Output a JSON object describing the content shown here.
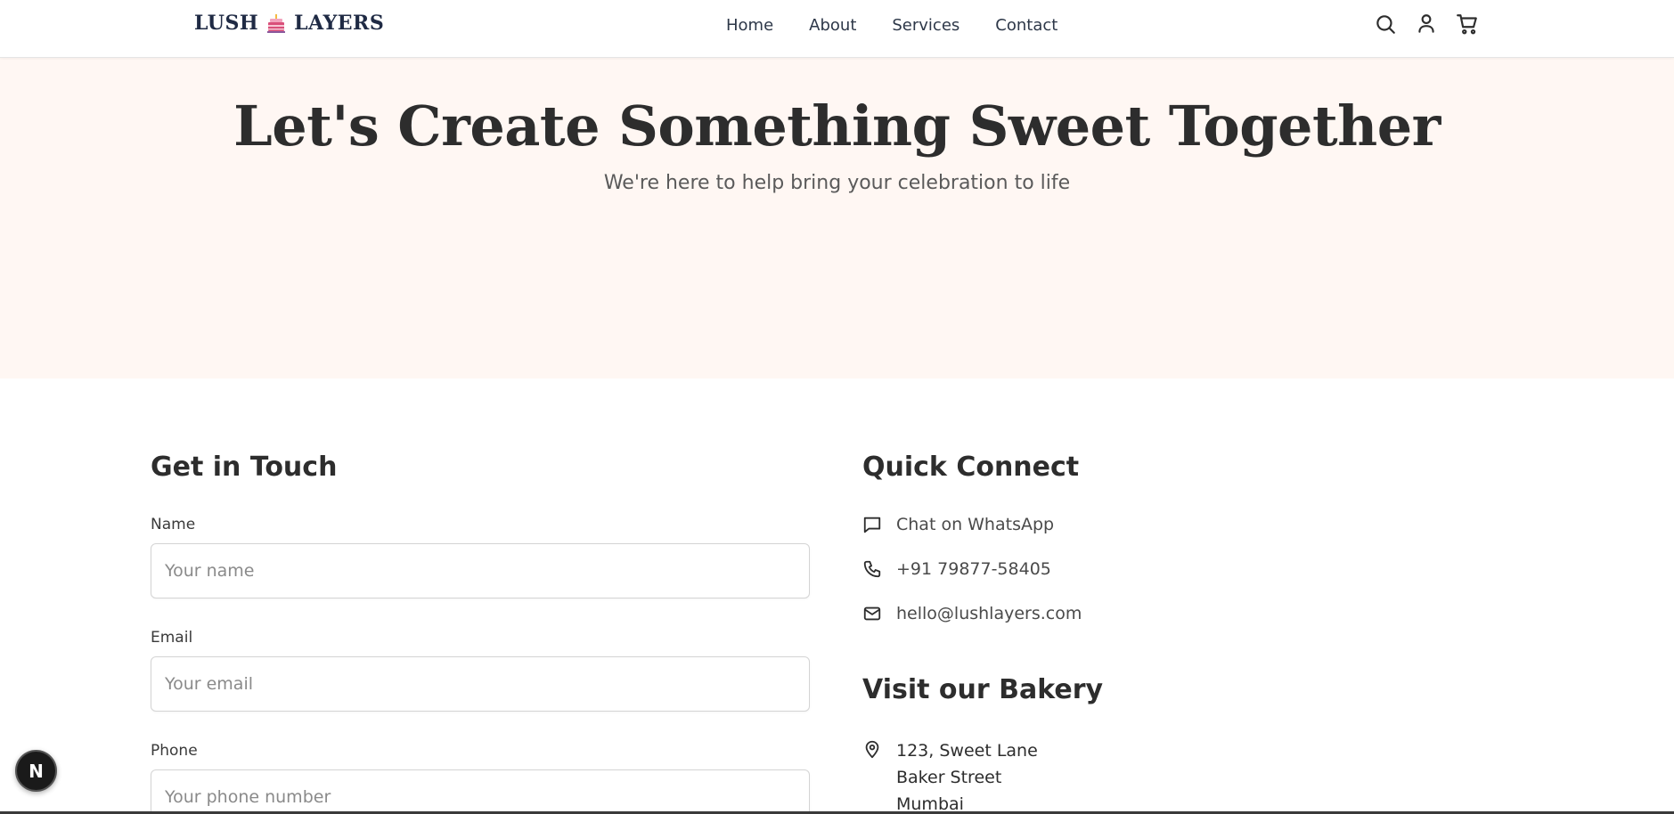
{
  "header": {
    "logo_left": "LUSH",
    "logo_right": "LAYERS",
    "nav": [
      "Home",
      "About",
      "Services",
      "Contact"
    ],
    "icons": [
      "search-icon",
      "user-icon",
      "cart-icon"
    ]
  },
  "hero": {
    "title": "Let's Create Something Sweet Together",
    "subtitle": "We're here to help bring your celebration to life"
  },
  "form": {
    "title": "Get in Touch",
    "fields": [
      {
        "label": "Name",
        "placeholder": "Your name"
      },
      {
        "label": "Email",
        "placeholder": "Your email"
      },
      {
        "label": "Phone",
        "placeholder": "Your phone number"
      }
    ]
  },
  "connect": {
    "title": "Quick Connect",
    "items": [
      {
        "icon": "chat-icon",
        "text": "Chat on WhatsApp"
      },
      {
        "icon": "phone-icon",
        "text": "+91 79877-58405"
      },
      {
        "icon": "mail-icon",
        "text": "hello@lushlayers.com"
      }
    ]
  },
  "visit": {
    "title": "Visit our Bakery",
    "icon": "location-pin-icon",
    "address": [
      "123, Sweet Lane",
      "Baker Street",
      "Mumbai"
    ]
  },
  "badge": {
    "letter": "N"
  },
  "colors": {
    "hero_bg": "#fff7f3",
    "text_dark": "#2d2d2d",
    "logo_navy": "#1f2a44"
  }
}
